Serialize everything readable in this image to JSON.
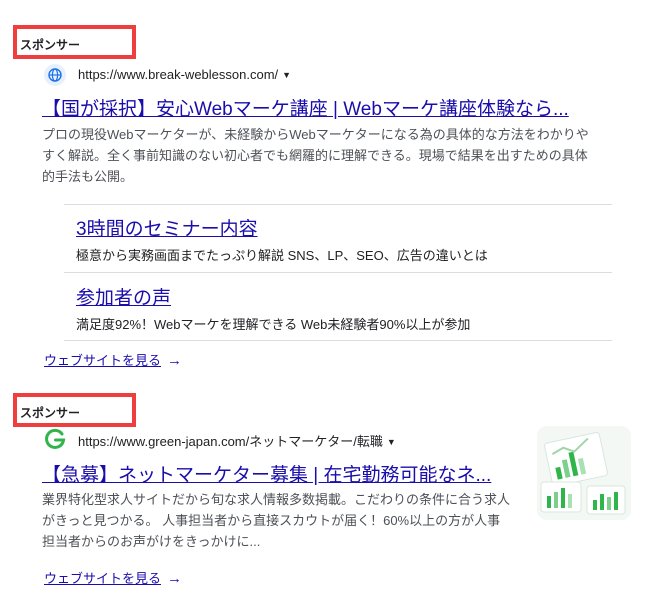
{
  "ads": [
    {
      "sponsor_label": "スポンサー",
      "favicon": "globe-icon",
      "url": "https://www.break-weblesson.com/",
      "title": "【国が採択】安心Webマーケ講座 | Webマーケ講座体験なら...",
      "description": [
        "プロの現役Webマーケターが、未経験からWebマーケターになる為の具体的な方法をわかりや",
        "すく解説。全く事前知識のない初心者でも網羅的に理解できる。現場で結果を出すための具体",
        "的手法も公開。"
      ],
      "sitelinks": [
        {
          "title": "3時間のセミナー内容",
          "description": "極意から実務画面までたっぷり解説 SNS、LP、SEO、広告の違いとは"
        },
        {
          "title": "参加者の声",
          "description": "満足度92%！Webマーケを理解できる Web未経験者90%以上が参加"
        }
      ],
      "visit_label": "ウェブサイトを見る"
    },
    {
      "sponsor_label": "スポンサー",
      "favicon": "green-g-logo-icon",
      "url": "https://www.green-japan.com/ネットマーケター/転職",
      "title": "【急募】ネットマーケター募集 | 在宅勤務可能なネ...",
      "description": [
        "業界特化型求人サイトだから旬な求人情報多数掲載。こだわりの条件に合う求人",
        "がきっと見つかる。 人事担当者から直接スカウトが届く！60%以上の方が人事",
        "担当者からのお声がけをきっかけに..."
      ],
      "visit_label": "ウェブサイトを見る",
      "thumbnail": "chart-thumbnail"
    }
  ],
  "colors": {
    "highlight": "#ef3e3e",
    "link": "#1a0dab",
    "green": "#2fb54a"
  }
}
